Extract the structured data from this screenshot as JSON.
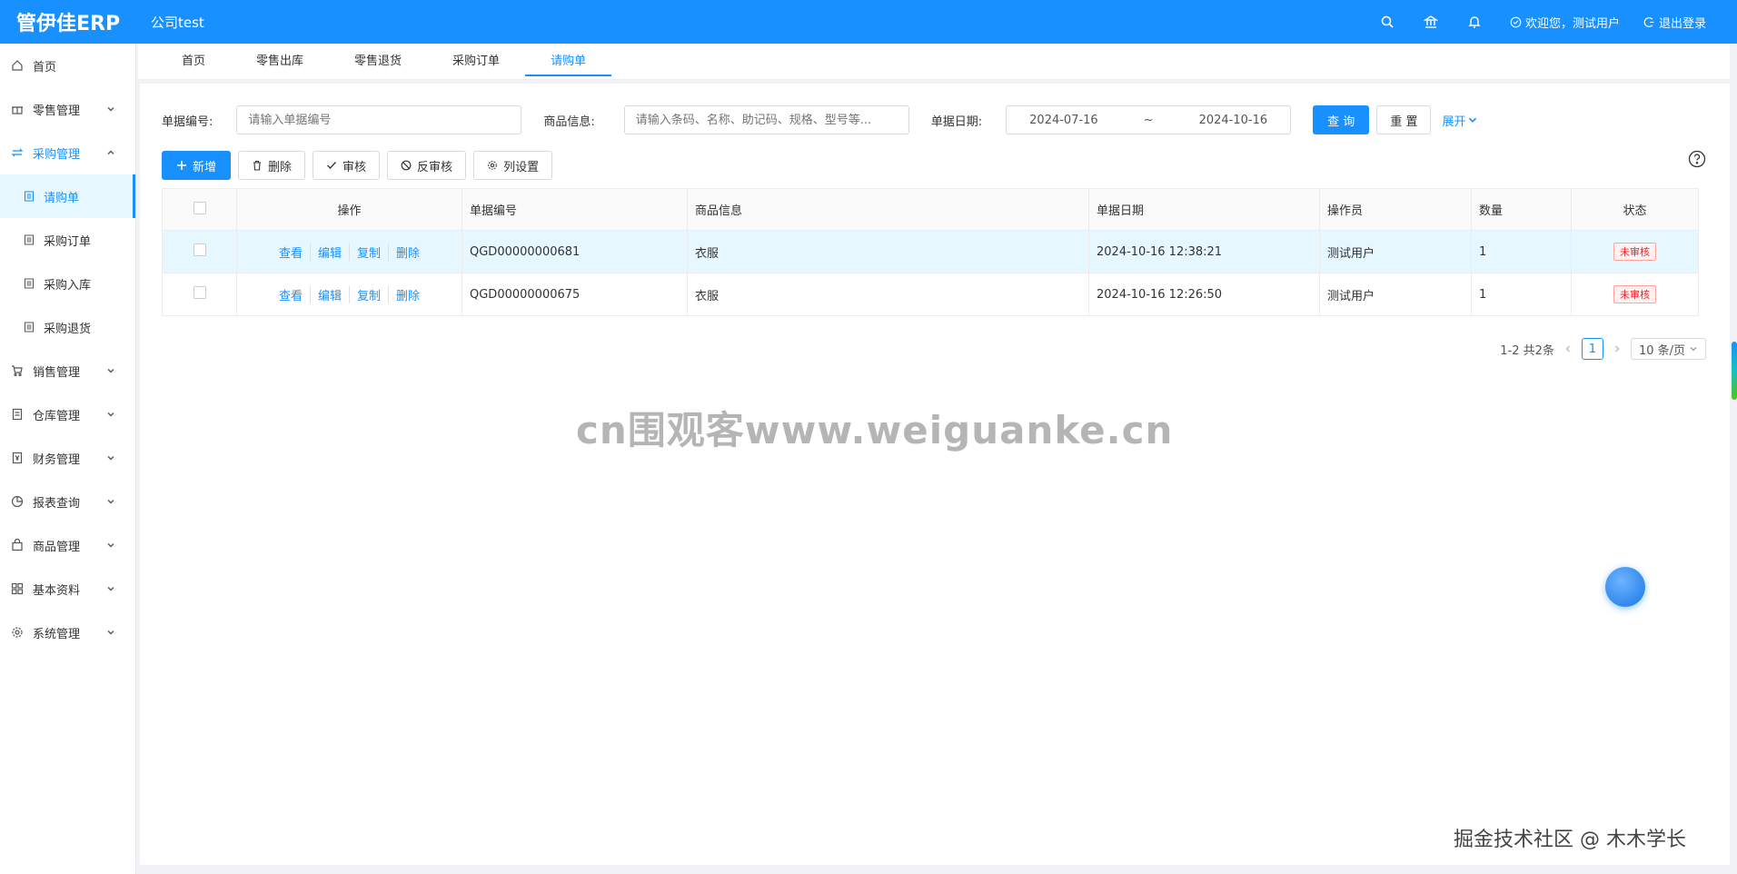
{
  "header": {
    "logo": "管伊佳ERP",
    "company": "公司test",
    "welcome": "欢迎您，测试用户",
    "logout": "退出登录"
  },
  "sidebar": {
    "items": [
      {
        "label": "首页",
        "icon": "home-icon"
      },
      {
        "label": "零售管理",
        "icon": "gift-icon"
      },
      {
        "label": "采购管理",
        "icon": "swap-icon"
      },
      {
        "label": "销售管理",
        "icon": "cart-icon"
      },
      {
        "label": "仓库管理",
        "icon": "book-icon"
      },
      {
        "label": "财务管理",
        "icon": "money-icon"
      },
      {
        "label": "报表查询",
        "icon": "pie-icon"
      },
      {
        "label": "商品管理",
        "icon": "bag-icon"
      },
      {
        "label": "基本资料",
        "icon": "grid-icon"
      },
      {
        "label": "系统管理",
        "icon": "gear-icon"
      }
    ],
    "sub_items": [
      "请购单",
      "采购订单",
      "采购入库",
      "采购退货"
    ]
  },
  "tabs": [
    "首页",
    "零售出库",
    "零售退货",
    "采购订单",
    "请购单"
  ],
  "filters": {
    "bill_no_label": "单据编号:",
    "bill_no_placeholder": "请输入单据编号",
    "goods_label": "商品信息:",
    "goods_placeholder": "请输入条码、名称、助记码、规格、型号等...",
    "date_label": "单据日期:",
    "date_start": "2024-07-16",
    "date_sep": "~",
    "date_end": "2024-10-16",
    "query": "查 询",
    "reset": "重 置",
    "expand": "展开"
  },
  "toolbar": {
    "add": "新增",
    "delete": "删除",
    "audit": "审核",
    "unaudit": "反审核",
    "columns": "列设置"
  },
  "table": {
    "headers": [
      "操作",
      "单据编号",
      "商品信息",
      "单据日期",
      "操作员",
      "数量",
      "状态"
    ],
    "ops": [
      "查看",
      "编辑",
      "复制",
      "删除"
    ],
    "rows": [
      {
        "no": "QGD00000000681",
        "goods": "衣服",
        "date": "2024-10-16 12:38:21",
        "operator": "测试用户",
        "qty": "1",
        "status": "未审核"
      },
      {
        "no": "QGD00000000675",
        "goods": "衣服",
        "date": "2024-10-16 12:26:50",
        "operator": "测试用户",
        "qty": "1",
        "status": "未审核"
      }
    ]
  },
  "pager": {
    "summary": "1-2 共2条",
    "current": "1",
    "size": "10 条/页"
  },
  "watermark": "cn围观客www.weiguanke.cn",
  "credit": "掘金技术社区 @ 木木学长"
}
